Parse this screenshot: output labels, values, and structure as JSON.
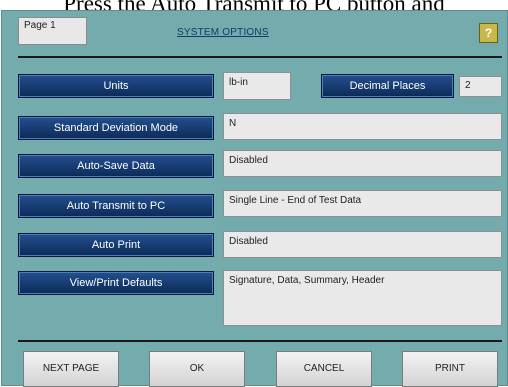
{
  "caption": "Press the Auto Transmit to PC button and",
  "header": {
    "page_label": "Page 1",
    "title": "SYSTEM OPTIONS",
    "help_label": "?"
  },
  "options": {
    "units": {
      "label": "Units",
      "value": "lb-in"
    },
    "decimal_places": {
      "label": "Decimal Places",
      "value": "2"
    },
    "std_dev_mode": {
      "label": "Standard Deviation Mode",
      "value": "N"
    },
    "auto_save": {
      "label": "Auto-Save Data",
      "value": "Disabled"
    },
    "auto_transmit": {
      "label": "Auto Transmit to PC",
      "value": "Single  Line - End of Test Data"
    },
    "auto_print": {
      "label": "Auto Print",
      "value": "Disabled"
    },
    "view_print_defaults": {
      "label": "View/Print Defaults",
      "value": "Signature, Data, Summary, Header"
    }
  },
  "footer": {
    "next_page": "NEXT PAGE",
    "ok": "OK",
    "cancel": "CANCEL",
    "print": "PRINT"
  },
  "colors": {
    "panel": "#74abac",
    "button": "#1a4078",
    "help": "#c9b74a"
  }
}
